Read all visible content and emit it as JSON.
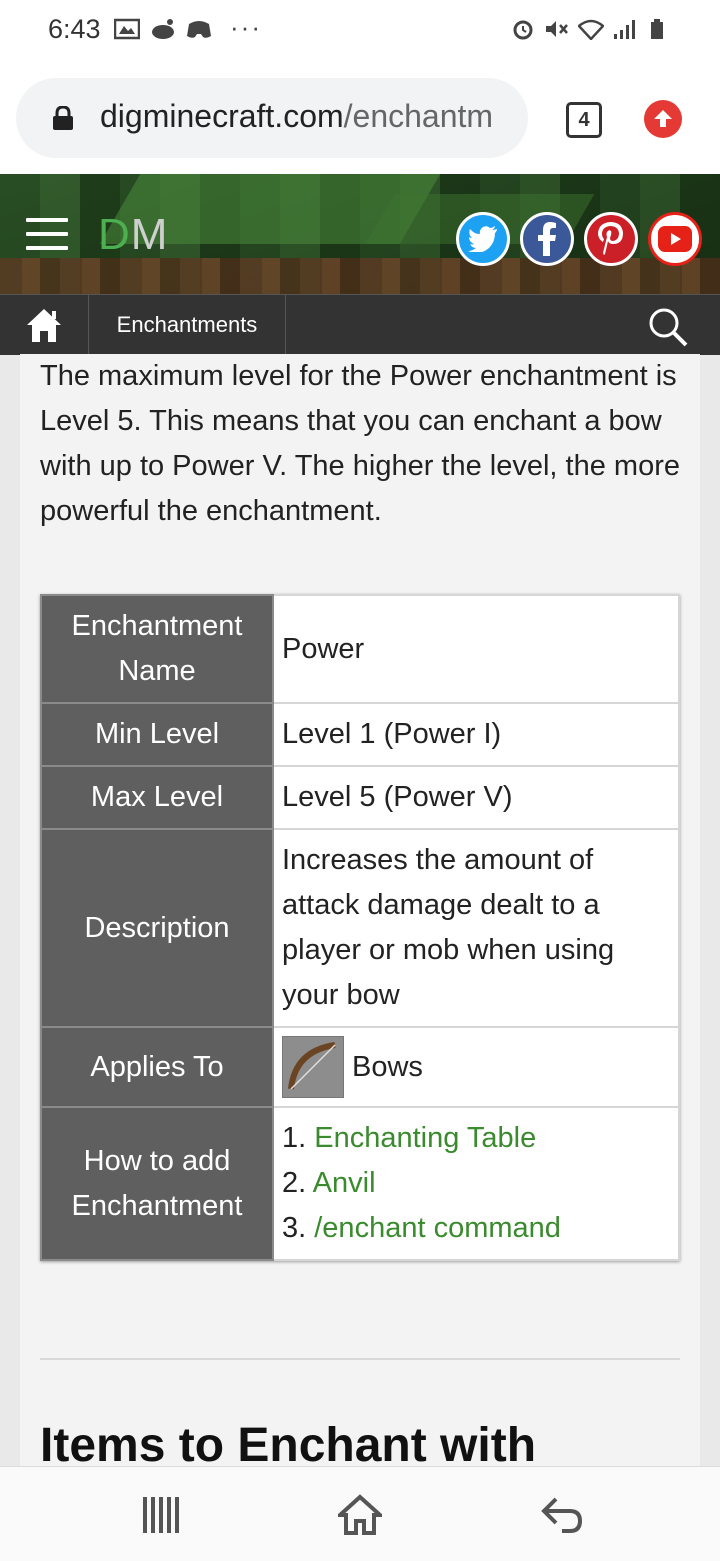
{
  "status_bar": {
    "time": "6:43",
    "more_indicator": "···"
  },
  "browser": {
    "url_host": "digminecraft.com",
    "url_path": "/enchantm",
    "tab_count": "4"
  },
  "site": {
    "logo_d": "D",
    "logo_m": "M",
    "colors": {
      "logo_green": "#4caf50",
      "link_green": "#3a8a2e",
      "label_bg": "#5f5f5f"
    }
  },
  "nav": {
    "breadcrumb": "Enchantments"
  },
  "content": {
    "intro": "The maximum level for the Power enchantment is Level 5. This means that you can enchant a bow with up to Power V. The higher the level, the more powerful the enchantment.",
    "table": {
      "name_label": "Enchantment Name",
      "name_value": "Power",
      "min_label": "Min Level",
      "min_value": "Level 1 (Power I)",
      "max_label": "Max Level",
      "max_value": "Level 5 (Power V)",
      "desc_label": "Description",
      "desc_value": "Increases the amount of attack damage dealt to a player or mob when using your bow",
      "applies_label": "Applies To",
      "applies_value": "Bows",
      "how_label": "How to add Enchantment",
      "how_items": [
        "1.",
        "Enchanting Table",
        "2.",
        "Anvil",
        "3.",
        "/enchant command"
      ]
    },
    "next_heading": "Items to Enchant with"
  }
}
